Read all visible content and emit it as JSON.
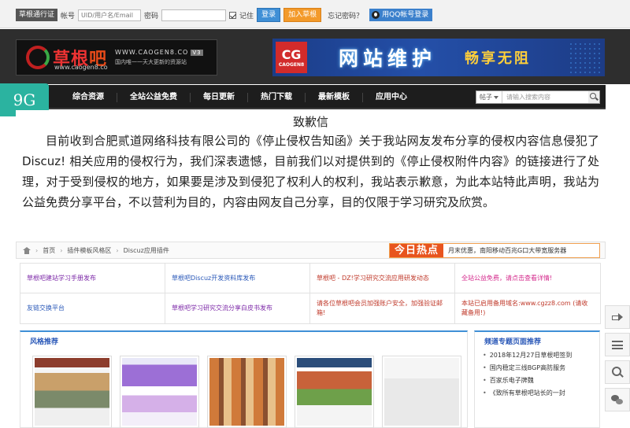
{
  "topbar": {
    "tag": "草根通行证",
    "account_label": "帐号",
    "account_placeholder": "UID/用户名/Email",
    "password_label": "密码",
    "remember_label": "记住",
    "login_button": "登录",
    "join_button": "加入草根",
    "forgot_link": "忘记密码？",
    "qq_button": "用QQ帐号登录"
  },
  "logo": {
    "name_a": "草根",
    "name_b": "吧",
    "url": "www.caogen8.co",
    "domain": "WWW.CAOGEN8.CO",
    "version": "V3",
    "slogan": "国内唯一一天大更新的资源站"
  },
  "banner": {
    "cg": "CG",
    "cg_sub": "CAOGEN8",
    "main": "网站维护",
    "sub": "畅享无阻"
  },
  "badge": "9G",
  "nav": {
    "items": [
      "综合资源",
      "全站公益免费",
      "每日更新",
      "热门下载",
      "最新模板",
      "应用中心"
    ],
    "search_select": "帖子",
    "search_placeholder": "请输入搜索内容"
  },
  "apology": {
    "title": "致歉信",
    "body": "目前收到合肥贰道网络科技有限公司的《停止侵权告知函》关于我站网友发布分享的侵权内容信息侵犯了Discuz! 相关应用的侵权行为，我们深表遗憾，目前我们以对提供到的《停止侵权附件内容》的链接进行了处理，对于受到侵权的地方，如果要是涉及到侵犯了权利人的权利，我站表示歉意，为此本站特此声明，我站为公益免费分享平台，不以营利为目的，内容由网友自己分享，目的仅限于学习研究及欣赏。"
  },
  "breadcrumb": {
    "items": [
      "首页",
      "插件模板风格区",
      "Discuz应用插件"
    ],
    "separator": "›",
    "hot_tag": "今日热点",
    "hot_text": "月末优惠，南阳移动百兆G口大带宽服务器"
  },
  "links": [
    {
      "text": "草根吧建站学习手册发布",
      "color": "purple"
    },
    {
      "text": "草根吧Discuz开发资料库发布",
      "color": "blue"
    },
    {
      "text": "草根吧 - DZ!学习研究交流应用研发动态",
      "color": "red"
    },
    {
      "text": "全站公益免费，请点击查看详情!",
      "color": "pink"
    },
    {
      "text": "友链交换平台",
      "color": "blue"
    },
    {
      "text": "草根吧学习研究交流分享白皮书发布",
      "color": "purple"
    },
    {
      "text": "请各位草根吧会员加强账户安全，加强验证邮箱!",
      "color": "red"
    },
    {
      "text": "本站已启用备用域名:www.cgzz8.com (请收藏备用!)",
      "color": "red"
    }
  ],
  "styles": {
    "title": "风格推荐"
  },
  "topics": {
    "title": "频道专题页面推荐",
    "items": [
      "2018年12月27日草根吧签到",
      "国内稳定三线BGP高防服务",
      "百家乐电子牌魏",
      "《致所有草根吧站长的一封"
    ]
  },
  "colors": {
    "purple": "#7d2aa8",
    "blue": "#2a58b8",
    "red": "#c03a2b",
    "pink": "#d42a8c",
    "accent": "#3f8fd6",
    "hot": "#e8541e"
  },
  "side_icons": [
    "share-icon",
    "menu-icon",
    "search-icon",
    "wechat-icon"
  ]
}
